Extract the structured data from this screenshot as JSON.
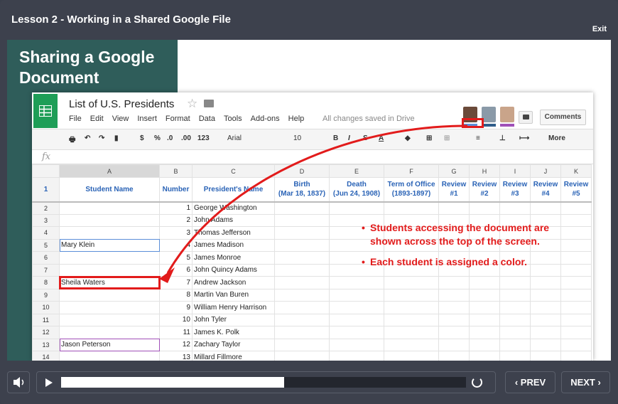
{
  "player": {
    "lesson_title": "Lesson 2 - Working in a Shared Google File",
    "exit_label": "Exit",
    "prev_label": "‹ PREV",
    "next_label": "NEXT ›",
    "progress": 0.55
  },
  "slide": {
    "heading_line1": "Sharing a Google",
    "heading_line2": "Document",
    "callout_1a": "Students accessing the document are",
    "callout_1b": "shown across the top of the screen.",
    "callout_2": "Each student is assigned a color."
  },
  "sheet": {
    "title": "List of U.S. Presidents",
    "menu": [
      "File",
      "Edit",
      "View",
      "Insert",
      "Format",
      "Data",
      "Tools",
      "Add-ons",
      "Help"
    ],
    "saved_status": "All changes saved in Drive",
    "comments_label": "Comments",
    "font_name": "Arial",
    "font_size": "10",
    "zoom_format": "123",
    "more_label": "More",
    "fx": "fx",
    "avatar_colors": [
      "#5b8ed8",
      "#2f5d8a",
      "#a050b8"
    ],
    "columns": [
      "A",
      "B",
      "C",
      "D",
      "E",
      "F",
      "G",
      "H",
      "I",
      "J",
      "K"
    ],
    "header_row": {
      "num": "1",
      "cells": [
        "Student Name",
        "Number",
        "President's Name",
        "Birth\n(Mar 18, 1837)",
        "Death\n(Jun 24, 1908)",
        "Term of Office\n(1893-1897)",
        "Review\n#1",
        "Review\n#2",
        "Review\n#3",
        "Review\n#4",
        "Review\n#5"
      ]
    },
    "rows": [
      {
        "num": "2",
        "student": "",
        "number": "1",
        "president": "George Washington"
      },
      {
        "num": "3",
        "student": "",
        "number": "2",
        "president": "John Adams"
      },
      {
        "num": "4",
        "student": "",
        "number": "3",
        "president": "Thomas Jefferson"
      },
      {
        "num": "5",
        "student": "Mary Klein",
        "number": "4",
        "president": "James Madison"
      },
      {
        "num": "6",
        "student": "",
        "number": "5",
        "president": "James Monroe"
      },
      {
        "num": "7",
        "student": "",
        "number": "6",
        "president": "John Quincy Adams"
      },
      {
        "num": "8",
        "student": "Sheila Waters",
        "number": "7",
        "president": "Andrew Jackson"
      },
      {
        "num": "9",
        "student": "",
        "number": "8",
        "president": "Martin Van Buren"
      },
      {
        "num": "10",
        "student": "",
        "number": "9",
        "president": "William Henry Harrison"
      },
      {
        "num": "11",
        "student": "",
        "number": "10",
        "president": "John Tyler"
      },
      {
        "num": "12",
        "student": "",
        "number": "11",
        "president": "James K. Polk"
      },
      {
        "num": "13",
        "student": "Jason Peterson",
        "number": "12",
        "president": "Zachary Taylor"
      },
      {
        "num": "14",
        "student": "",
        "number": "13",
        "president": "Millard Fillmore"
      }
    ]
  }
}
